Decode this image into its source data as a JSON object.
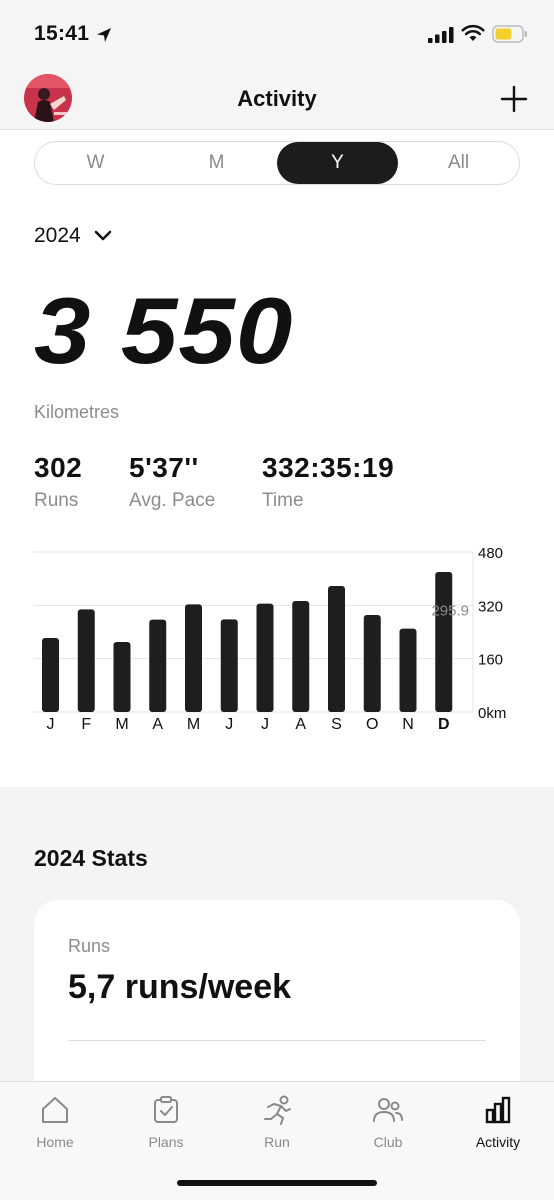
{
  "status_bar": {
    "time": "15:41"
  },
  "header": {
    "title": "Activity"
  },
  "segments": [
    {
      "label": "W",
      "active": false
    },
    {
      "label": "M",
      "active": false
    },
    {
      "label": "Y",
      "active": true
    },
    {
      "label": "All",
      "active": false
    }
  ],
  "year": "2024",
  "summary": {
    "distance": "3 550",
    "distance_unit": "Kilometres",
    "runs_value": "302",
    "runs_label": "Runs",
    "pace_value": "5'37''",
    "pace_label": "Avg. Pace",
    "time_value": "332:35:19",
    "time_label": "Time"
  },
  "chart_data": {
    "type": "bar",
    "categories": [
      "J",
      "F",
      "M",
      "A",
      "M",
      "J",
      "J",
      "A",
      "S",
      "O",
      "N",
      "D"
    ],
    "values": [
      222,
      308,
      210,
      277,
      323,
      278,
      325,
      333,
      378,
      291,
      250,
      420
    ],
    "highlight_index": 11,
    "average_label": "295.9",
    "average_value": 295.9,
    "y_ticks": [
      "480",
      "320",
      "160",
      "0km"
    ],
    "y_tick_values": [
      480,
      320,
      160,
      0
    ],
    "ylim": [
      0,
      480
    ],
    "grid": true,
    "colors": {
      "bar": "#1e1e1e",
      "grid": "#e6e6e6",
      "label": "#111111",
      "avg": "#8a8a8a"
    }
  },
  "stats": {
    "title": "2024 Stats",
    "card_label": "Runs",
    "card_value": "5,7 runs/week"
  },
  "tabs": [
    {
      "label": "Home",
      "icon": "home-icon",
      "active": false
    },
    {
      "label": "Plans",
      "icon": "plans-icon",
      "active": false
    },
    {
      "label": "Run",
      "icon": "run-icon",
      "active": false
    },
    {
      "label": "Club",
      "icon": "club-icon",
      "active": false
    },
    {
      "label": "Activity",
      "icon": "activity-icon",
      "active": true
    }
  ]
}
